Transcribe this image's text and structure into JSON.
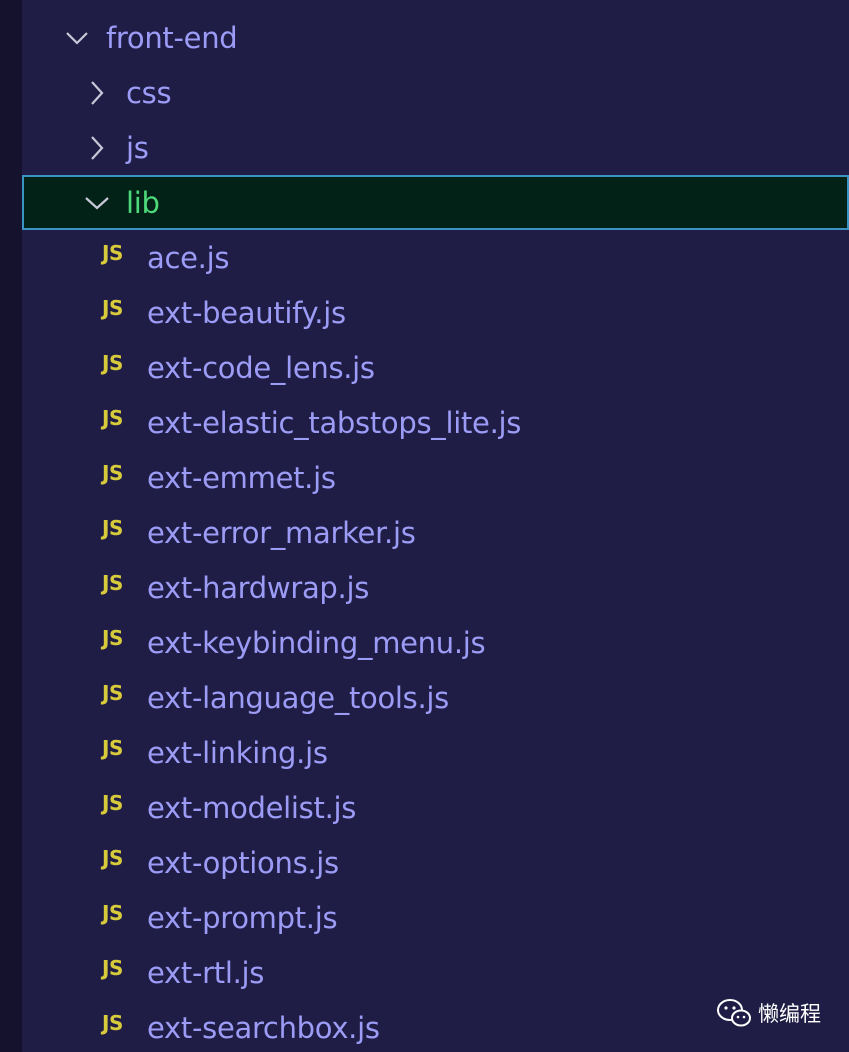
{
  "explorer": {
    "root_folder": {
      "label": "front-end",
      "expanded": true,
      "icon": "chevron-down-icon"
    },
    "subfolders": [
      {
        "label": "css",
        "expanded": false,
        "icon": "chevron-right-icon"
      },
      {
        "label": "js",
        "expanded": false,
        "icon": "chevron-right-icon"
      },
      {
        "label": "lib",
        "expanded": true,
        "selected": true,
        "icon": "chevron-down-icon"
      }
    ],
    "file_icon_text": "JS",
    "files": [
      "ace.js",
      "ext-beautify.js",
      "ext-code_lens.js",
      "ext-elastic_tabstops_lite.js",
      "ext-emmet.js",
      "ext-error_marker.js",
      "ext-hardwrap.js",
      "ext-keybinding_menu.js",
      "ext-language_tools.js",
      "ext-linking.js",
      "ext-modelist.js",
      "ext-options.js",
      "ext-prompt.js",
      "ext-rtl.js",
      "ext-searchbox.js"
    ]
  },
  "watermark": {
    "text": "懒编程",
    "icon": "wechat-icon"
  },
  "colors": {
    "background": "#1f1d45",
    "text": "#9c9cf6",
    "selected_text": "#4dd97a",
    "selected_bg": "#022218",
    "selected_border": "#3b93c4",
    "js_icon": "#d7cb3b"
  }
}
